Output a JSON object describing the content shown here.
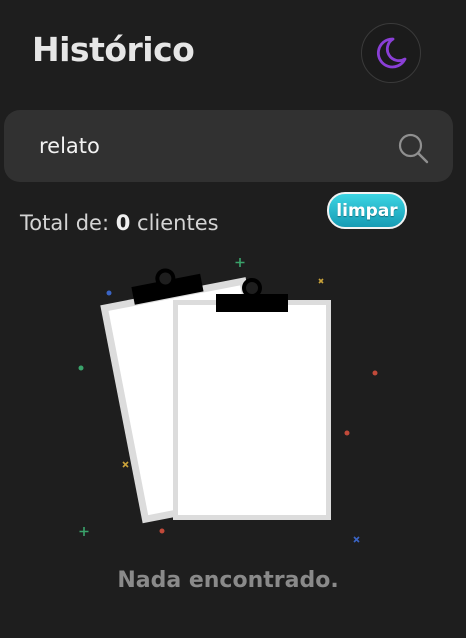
{
  "header": {
    "title": "Histórico"
  },
  "theme_toggle": {
    "icon": "moon-icon",
    "icon_color": "#8a3fd6"
  },
  "search": {
    "value": "relato",
    "icon": "search-icon"
  },
  "summary": {
    "prefix": "Total de:",
    "count": "0",
    "suffix": "clientes"
  },
  "clear_button": {
    "label": "limpar",
    "color": "#1fb4cc"
  },
  "empty_state": {
    "icon": "clipboard-icon",
    "message": "Nada encontrado."
  }
}
